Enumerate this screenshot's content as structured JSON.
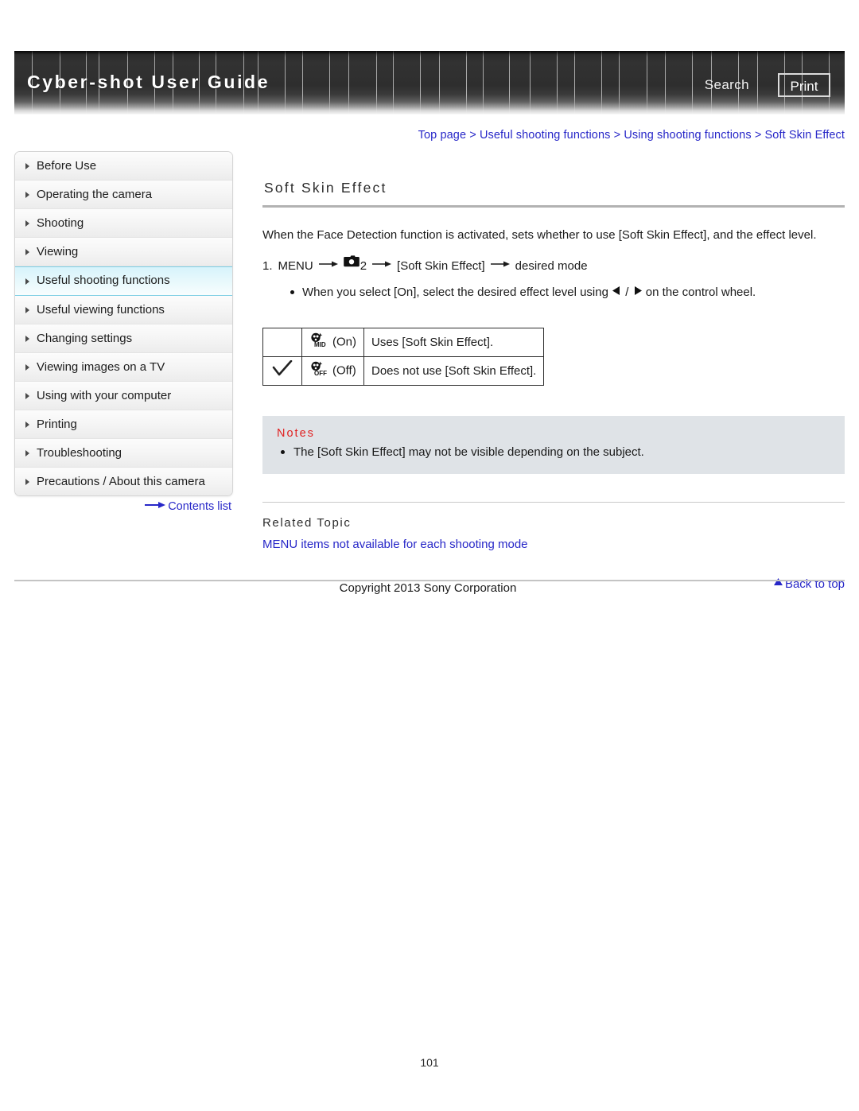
{
  "header": {
    "title": "Cyber-shot User Guide",
    "search_label": "Search",
    "print_label": "Print"
  },
  "breadcrumb": {
    "items": [
      "Top page",
      "Useful shooting functions",
      "Using shooting functions",
      "Soft Skin Effect"
    ],
    "separator": ">"
  },
  "sidebar": {
    "items": [
      {
        "label": "Before Use",
        "active": false
      },
      {
        "label": "Operating the camera",
        "active": false
      },
      {
        "label": "Shooting",
        "active": false
      },
      {
        "label": "Viewing",
        "active": false
      },
      {
        "label": "Useful shooting functions",
        "active": true
      },
      {
        "label": "Useful viewing functions",
        "active": false
      },
      {
        "label": "Changing settings",
        "active": false
      },
      {
        "label": "Viewing images on a TV",
        "active": false
      },
      {
        "label": "Using with your computer",
        "active": false
      },
      {
        "label": "Printing",
        "active": false
      },
      {
        "label": "Troubleshooting",
        "active": false
      },
      {
        "label": "Precautions / About this camera",
        "active": false
      }
    ],
    "contents_list_label": "Contents list"
  },
  "main": {
    "title": "Soft Skin Effect",
    "intro": "When the Face Detection function is activated, sets whether to use [Soft Skin Effect], and the effect level.",
    "step_number": "1.",
    "step_menu": "MENU",
    "step_tab_number": "2",
    "step_item": "[Soft Skin Effect]",
    "step_result": "desired mode",
    "sub_bullet_pre": "When you select [On], select the desired effect level using",
    "sub_bullet_sep": "/",
    "sub_bullet_post": "on the control wheel.",
    "table": {
      "rows": [
        {
          "checked": "",
          "icon_label": "MID",
          "mode": "(On)",
          "description": "Uses [Soft Skin Effect]."
        },
        {
          "checked": "checkmark",
          "icon_label": "OFF",
          "mode": "(Off)",
          "description": "Does not use [Soft Skin Effect]."
        }
      ]
    },
    "notes": {
      "title": "Notes",
      "items": [
        "The [Soft Skin Effect] may not be visible depending on the subject."
      ]
    },
    "related": {
      "title": "Related Topic",
      "links": [
        "MENU items not available for each shooting mode"
      ]
    },
    "back_to_top": "Back to top"
  },
  "footer": {
    "copyright": "Copyright 2013 Sony Corporation",
    "page_number": "101"
  },
  "colors": {
    "link": "#2727c8",
    "notes_title": "#e02020",
    "active_nav_border": "#7ecfe4",
    "notes_bg": "#dfe3e7"
  }
}
